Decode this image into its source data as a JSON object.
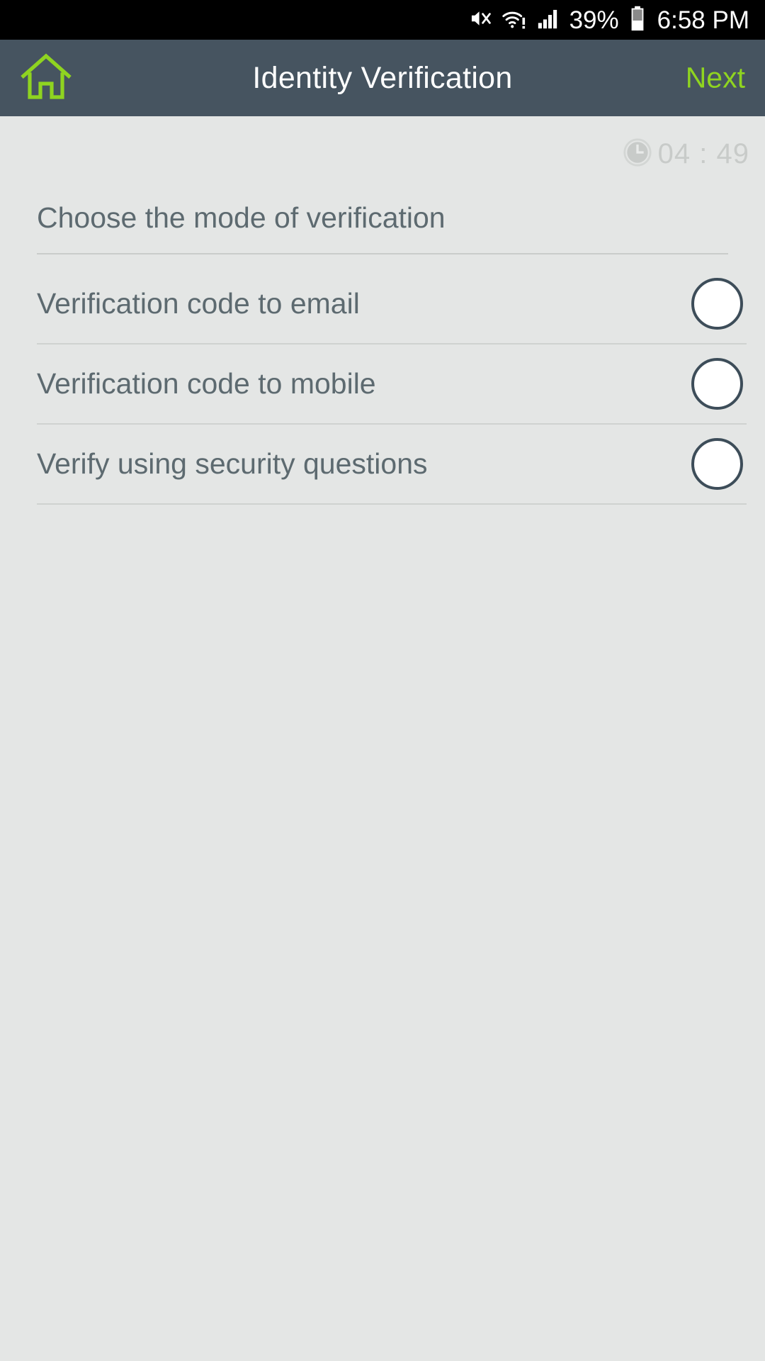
{
  "status_bar": {
    "icons": [
      "mute-icon",
      "wifi-alert-icon",
      "signal-bars-icon",
      "battery-icon"
    ],
    "battery_percent": "39%",
    "time": "6:58 PM"
  },
  "header": {
    "home_icon": "home-icon",
    "title": "Identity Verification",
    "next_label": "Next",
    "accent_color": "#8fd420",
    "background_color": "#465460"
  },
  "timer": {
    "icon": "clock-icon",
    "value": "04 : 49"
  },
  "form": {
    "section_label": "Choose the mode of verification",
    "options": [
      {
        "label": "Verification code to email",
        "selected": false
      },
      {
        "label": "Verification code to mobile",
        "selected": false
      },
      {
        "label": "Verify using security questions",
        "selected": false
      }
    ]
  },
  "colors": {
    "page_background": "#e4e6e5",
    "text": "#5d6a70",
    "divider": "#cfd2d0",
    "radio_border": "#3d4d59"
  }
}
